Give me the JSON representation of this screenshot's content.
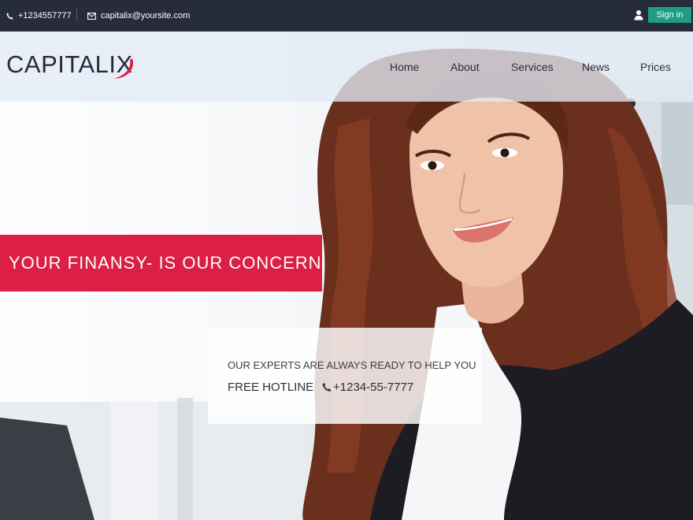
{
  "topbar": {
    "phone": "+1234557777",
    "email": "capitalix@yoursite.com",
    "signin_label": "Sign in"
  },
  "logo": {
    "text": "CAPITALIX"
  },
  "nav": {
    "items": [
      {
        "label": "Home"
      },
      {
        "label": "About"
      },
      {
        "label": "Services"
      },
      {
        "label": "News"
      },
      {
        "label": "Prices"
      }
    ]
  },
  "hero": {
    "tagline": "YOUR FINANSY- IS OUR CONCERN",
    "info_line": "OUR EXPERTS ARE ALWAYS READY TO HELP YOU",
    "hotline_label": "FREE HOTLINE",
    "hotline_number": "+1234-55-7777"
  },
  "colors": {
    "topbar_bg": "#272c3a",
    "accent_red": "#dc1f44",
    "signin_green": "#1f9c86",
    "text_dark": "#262a3b"
  }
}
